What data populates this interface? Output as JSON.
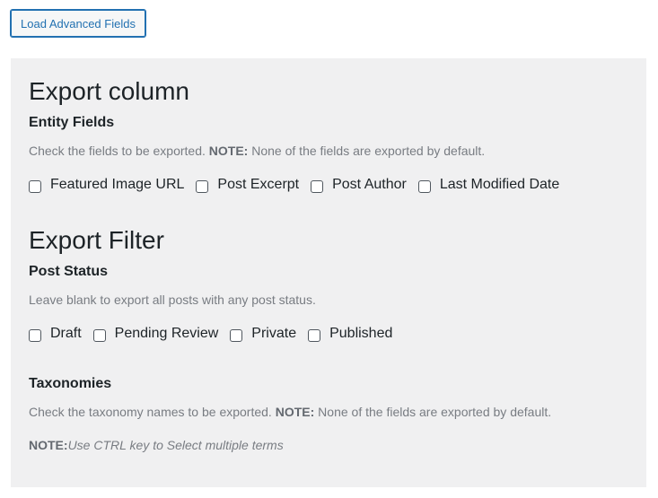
{
  "load_button": "Load Advanced Fields",
  "export_column": {
    "title": "Export column",
    "entity_fields": {
      "heading": "Entity Fields",
      "desc_text": "Check the fields to be exported. ",
      "desc_note_label": "NOTE:",
      "desc_note_text": " None of the fields are exported by default.",
      "options": [
        "Featured Image URL",
        "Post Excerpt",
        "Post Author",
        "Last Modified Date"
      ]
    }
  },
  "export_filter": {
    "title": "Export Filter",
    "post_status": {
      "heading": "Post Status",
      "desc": "Leave blank to export all posts with any post status.",
      "options": [
        "Draft",
        "Pending Review",
        "Private",
        "Published"
      ]
    },
    "taxonomies": {
      "heading": "Taxonomies",
      "desc_text": "Check the taxonomy names to be exported. ",
      "desc_note_label": "NOTE:",
      "desc_note_text": " None of the fields are exported by default.",
      "note_label": "NOTE:",
      "note_text": "Use CTRL key to Select multiple terms"
    }
  }
}
